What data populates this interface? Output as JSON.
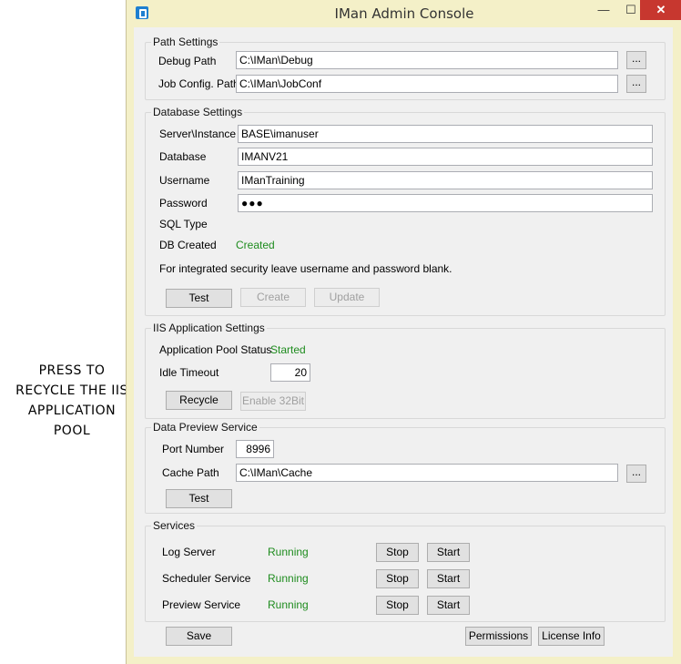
{
  "callout": {
    "line1": "PRESS TO",
    "line2": "RECYCLE THE IIS",
    "line3": "APPLICATION",
    "line4": "POOL"
  },
  "window": {
    "title": "IMan Admin Console",
    "minimize": "—",
    "maximize": "☐",
    "close": "✕"
  },
  "path_settings": {
    "title": "Path Settings",
    "debug_label": "Debug Path",
    "debug_value": "C:\\IMan\\Debug",
    "job_label": "Job Config. Path",
    "job_value": "C:\\IMan\\JobConf",
    "browse": "..."
  },
  "database_settings": {
    "title": "Database Settings",
    "server_label": "Server\\Instance",
    "server_value": "BASE\\imanuser",
    "database_label": "Database",
    "database_value": "IMANV21",
    "username_label": "Username",
    "username_value": "IManTraining",
    "password_label": "Password",
    "password_value": "●●●",
    "sqltype_label": "SQL Type",
    "dbcreated_label": "DB Created",
    "dbcreated_value": "Created",
    "note": "For integrated security leave username and password blank.",
    "test": "Test",
    "create": "Create",
    "update": "Update"
  },
  "iis_settings": {
    "title": "IIS Application Settings",
    "pool_label": "Application Pool Status",
    "pool_value": "Started",
    "idle_label": "Idle Timeout",
    "idle_value": "20",
    "recycle": "Recycle",
    "enable32": "Enable 32Bit"
  },
  "data_preview": {
    "title": "Data Preview Service",
    "port_label": "Port Number",
    "port_value": "8996",
    "cache_label": "Cache Path",
    "cache_value": "C:\\IMan\\Cache",
    "browse": "...",
    "test": "Test"
  },
  "services": {
    "title": "Services",
    "rows": [
      {
        "name": "Log Server",
        "status": "Running",
        "stop": "Stop",
        "start": "Start"
      },
      {
        "name": "Scheduler Service",
        "status": "Running",
        "stop": "Stop",
        "start": "Start"
      },
      {
        "name": "Preview Service",
        "status": "Running",
        "stop": "Stop",
        "start": "Start"
      }
    ]
  },
  "footer": {
    "save": "Save",
    "permissions": "Permissions",
    "license": "License Info"
  },
  "colors": {
    "window_frame": "#f4f0c8",
    "close_button": "#c7372f",
    "status_green": "#1e8c1e"
  }
}
